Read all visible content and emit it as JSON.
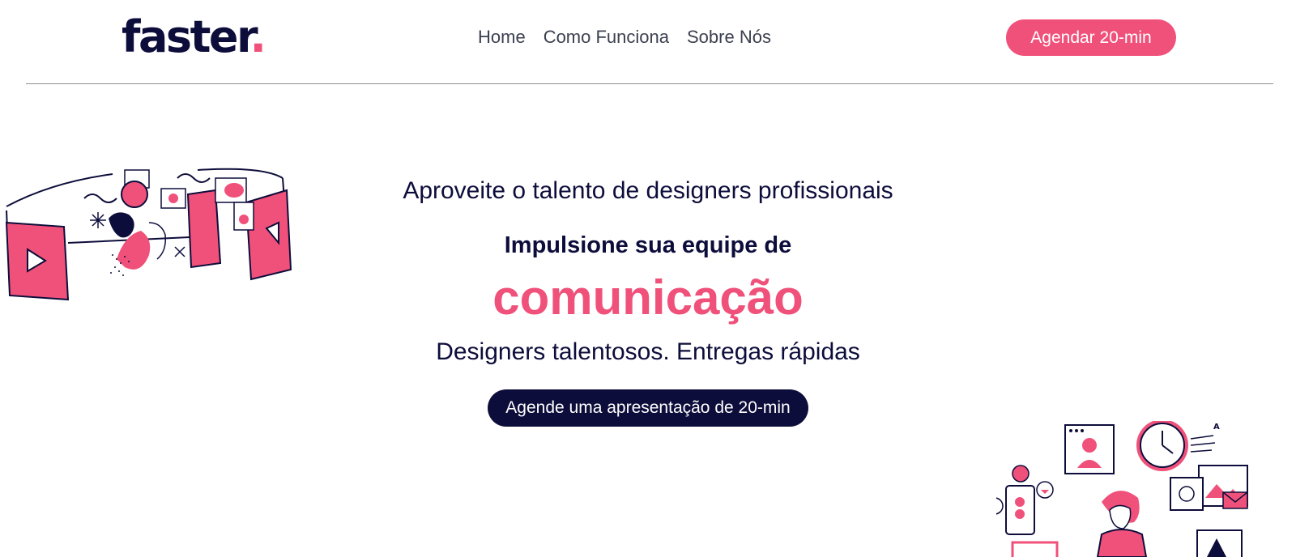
{
  "brand": {
    "name": "faster",
    "dot": ".",
    "accent": "#f0517a",
    "navy": "#0d0d3b"
  },
  "nav": {
    "items": [
      "Home",
      "Como Funciona",
      "Sobre Nós"
    ]
  },
  "header": {
    "cta_label": "Agendar 20-min"
  },
  "hero": {
    "tagline": "Aproveite o talento de designers profissionais",
    "headline": "Impulsione sua equipe de",
    "highlight": "comunicação",
    "subline": "Designers talentosos. Entregas rápidas",
    "cta_label": "Agende uma apresentação de 20-min"
  },
  "illustrations": {
    "left": "video-team-illustration",
    "right": "design-tools-illustration",
    "right_glyph": "A"
  }
}
